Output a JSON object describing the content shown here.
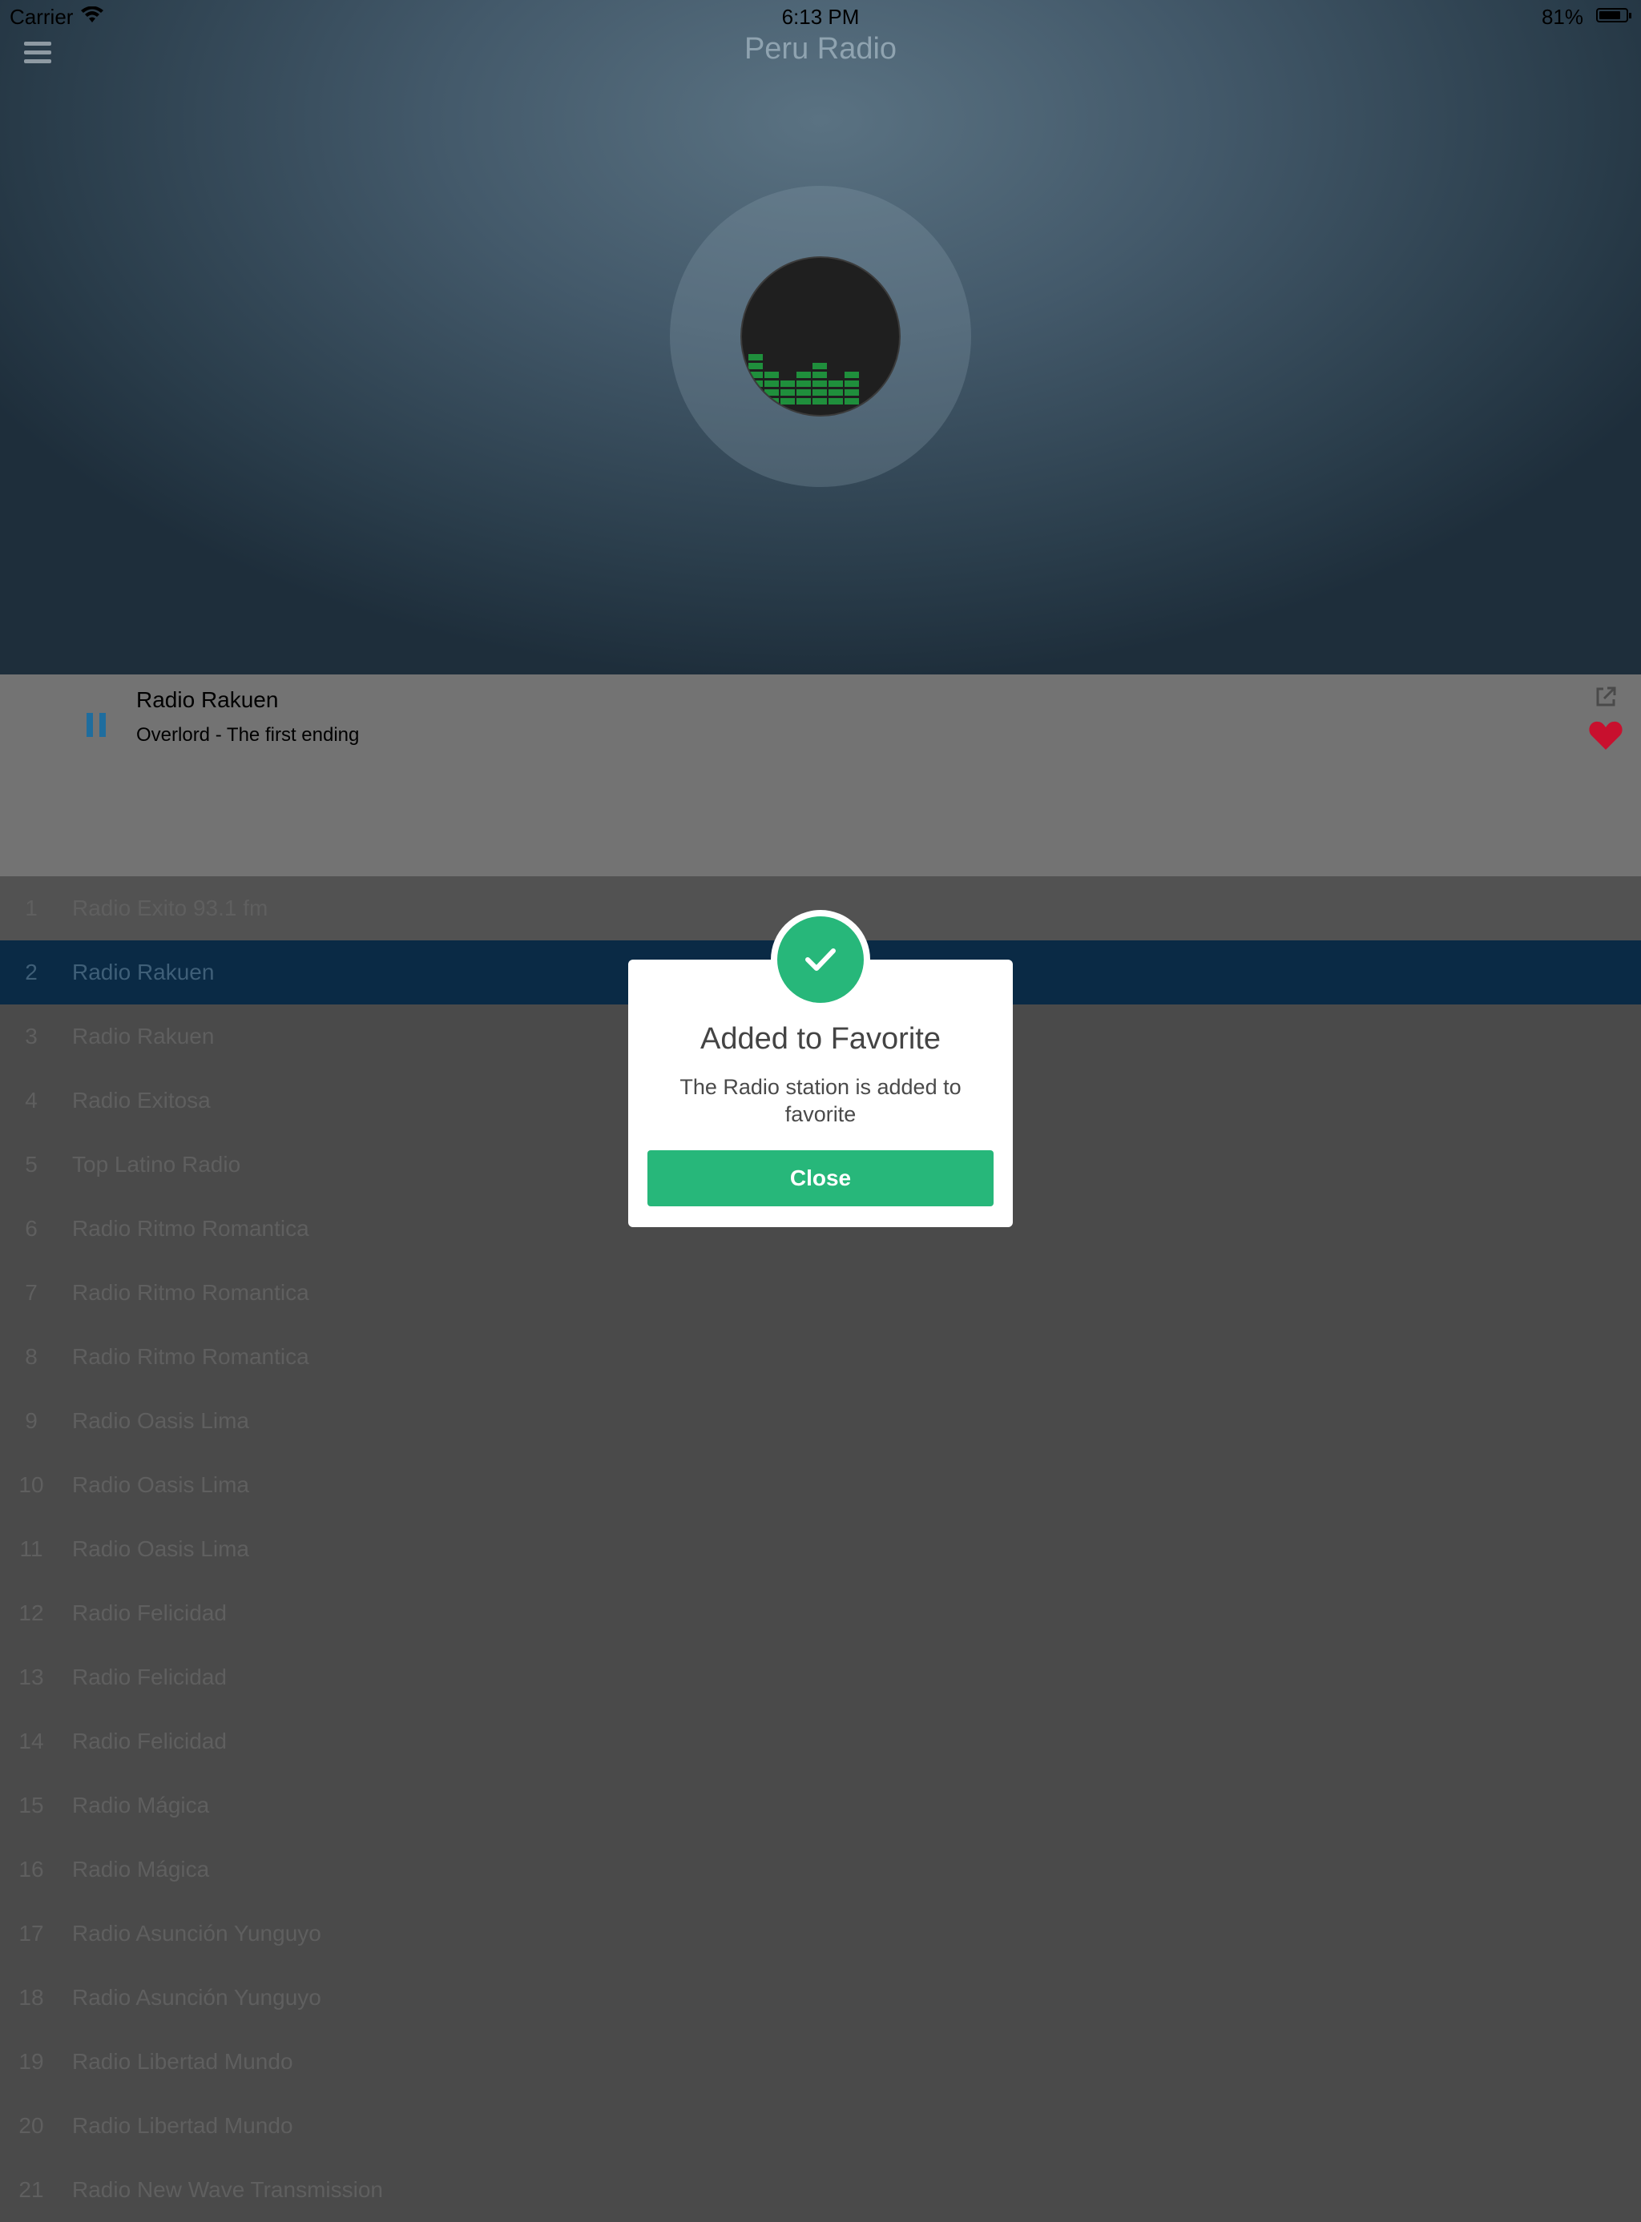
{
  "status_bar": {
    "carrier": "Carrier",
    "time": "6:13 PM",
    "battery": "81%"
  },
  "header": {
    "title": "Peru Radio"
  },
  "player": {
    "station": "Radio Rakuen",
    "track": "Overlord - The first ending"
  },
  "stations": [
    {
      "num": "1",
      "name": "Radio Exito 93.1 fm"
    },
    {
      "num": "2",
      "name": "Radio Rakuen"
    },
    {
      "num": "3",
      "name": "Radio Rakuen"
    },
    {
      "num": "4",
      "name": "Radio Exitosa"
    },
    {
      "num": "5",
      "name": "Top Latino Radio"
    },
    {
      "num": "6",
      "name": "Radio Ritmo Romantica"
    },
    {
      "num": "7",
      "name": "Radio Ritmo Romantica"
    },
    {
      "num": "8",
      "name": "Radio Ritmo Romantica"
    },
    {
      "num": "9",
      "name": "Radio Oasis Lima"
    },
    {
      "num": "10",
      "name": "Radio Oasis Lima"
    },
    {
      "num": "11",
      "name": "Radio Oasis Lima"
    },
    {
      "num": "12",
      "name": "Radio Felicidad"
    },
    {
      "num": "13",
      "name": "Radio Felicidad"
    },
    {
      "num": "14",
      "name": "Radio Felicidad"
    },
    {
      "num": "15",
      "name": "Radio Mágica"
    },
    {
      "num": "16",
      "name": "Radio Mágica"
    },
    {
      "num": "17",
      "name": "Radio Asunción Yunguyo"
    },
    {
      "num": "18",
      "name": "Radio Asunción Yunguyo"
    },
    {
      "num": "19",
      "name": "Radio Libertad Mundo"
    },
    {
      "num": "20",
      "name": "Radio Libertad Mundo"
    },
    {
      "num": "21",
      "name": "Radio New Wave Transmission"
    }
  ],
  "selected_index": 1,
  "dialog": {
    "title": "Added to Favorite",
    "message": "The Radio station is added to favorite",
    "button": "Close"
  },
  "colors": {
    "accent_green": "#27b77a",
    "selected_row": "#0a2a45",
    "heart_red": "#c8102e",
    "pause_blue": "#1f6d9e"
  }
}
